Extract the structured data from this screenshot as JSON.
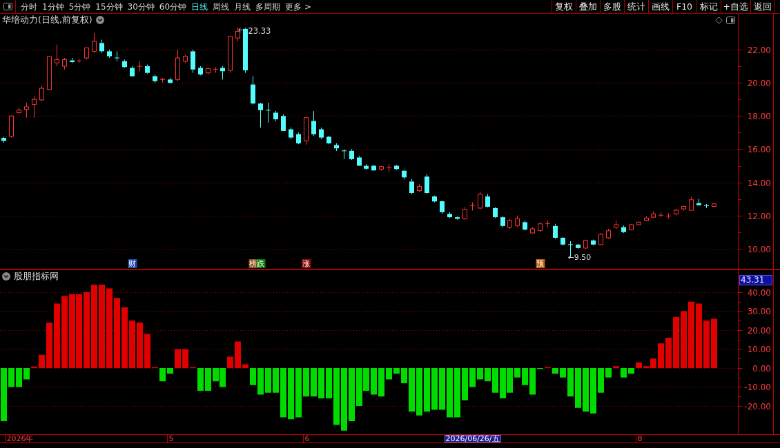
{
  "toolbar": {
    "periods": [
      {
        "label": "分时",
        "selected": false
      },
      {
        "label": "1分钟",
        "selected": false
      },
      {
        "label": "5分钟",
        "selected": false
      },
      {
        "label": "15分钟",
        "selected": false
      },
      {
        "label": "30分钟",
        "selected": false
      },
      {
        "label": "60分钟",
        "selected": false
      },
      {
        "label": "日线",
        "selected": true
      },
      {
        "label": "周线",
        "selected": false
      },
      {
        "label": "月线",
        "selected": false
      },
      {
        "label": "多周期",
        "selected": false
      }
    ],
    "more_menu": "更多 >",
    "buttons": [
      "复权",
      "叠加",
      "多股",
      "统计",
      "画线",
      "F10",
      "标记",
      "+自选",
      "返回"
    ]
  },
  "price_pane": {
    "title": "华培动力(日线,前复权)",
    "chart_data": [
      {
        "type": "candlestick",
        "grid": true,
        "ylim": [
          8.79,
          24.16
        ],
        "yticks": [
          {
            "value": 10,
            "label": "10.00"
          },
          {
            "value": 12,
            "label": "12.00"
          },
          {
            "value": 14,
            "label": "14.00"
          },
          {
            "value": 16,
            "label": "16.00"
          },
          {
            "value": 18,
            "label": "18.00"
          },
          {
            "value": 20,
            "label": "20.00"
          },
          {
            "value": 22,
            "label": "22.00"
          }
        ],
        "categories": [
          null,
          null,
          null,
          null,
          null,
          null,
          null,
          null,
          null,
          null,
          null,
          null,
          null,
          null,
          null,
          null,
          null,
          "财",
          null,
          null,
          null,
          null,
          null,
          null,
          null,
          null,
          null,
          null,
          null,
          null,
          null,
          null,
          null,
          "榜",
          "跌",
          null,
          null,
          null,
          null,
          null,
          "涨",
          null,
          null,
          null,
          null,
          null,
          null,
          null,
          null,
          null,
          null,
          null,
          null,
          null,
          null,
          null,
          null,
          null,
          null,
          null,
          null,
          null,
          null,
          null,
          null,
          null,
          null,
          null,
          null,
          null,
          null,
          "预",
          null,
          null,
          null,
          null,
          null,
          null,
          null,
          null,
          null,
          null,
          null,
          null,
          null,
          null,
          null,
          null,
          null,
          null,
          null,
          null,
          null,
          null,
          null
        ],
        "ohlc": [
          [
            16.68,
            16.75,
            16.4,
            16.5
          ],
          [
            16.78,
            18.05,
            16.7,
            18.0
          ],
          [
            18.2,
            18.5,
            18.1,
            18.35
          ],
          [
            18.4,
            18.8,
            17.9,
            18.55
          ],
          [
            18.7,
            19.2,
            17.9,
            19.0
          ],
          [
            18.97,
            19.8,
            18.9,
            19.67
          ],
          [
            19.6,
            21.6,
            19.55,
            21.58
          ],
          [
            21.2,
            22.3,
            21.0,
            21.4
          ],
          [
            21.0,
            21.5,
            20.8,
            21.4
          ],
          [
            21.35,
            21.5,
            21.2,
            21.25
          ],
          [
            21.3,
            21.45,
            21.2,
            21.32
          ],
          [
            21.5,
            22.15,
            21.4,
            22.1
          ],
          [
            21.9,
            23.0,
            21.8,
            22.5
          ],
          [
            22.4,
            22.6,
            21.8,
            21.9
          ],
          [
            21.9,
            22.0,
            21.5,
            21.6
          ],
          [
            21.5,
            21.9,
            21.3,
            21.45
          ],
          [
            21.3,
            21.4,
            20.9,
            20.95
          ],
          [
            20.9,
            21.0,
            20.35,
            20.4
          ],
          [
            20.95,
            21.3,
            20.7,
            21.0
          ],
          [
            21.0,
            21.1,
            20.55,
            20.6
          ],
          [
            20.4,
            20.5,
            20.0,
            20.1
          ],
          [
            20.15,
            20.3,
            20.0,
            20.2
          ],
          [
            20.2,
            20.3,
            19.95,
            20.0
          ],
          [
            20.2,
            22.0,
            20.1,
            21.5
          ],
          [
            21.3,
            21.7,
            21.2,
            21.6
          ],
          [
            21.9,
            22.0,
            20.6,
            20.8
          ],
          [
            20.9,
            21.0,
            20.45,
            20.5
          ],
          [
            20.6,
            20.9,
            20.5,
            20.85
          ],
          [
            20.8,
            20.95,
            20.6,
            20.82
          ],
          [
            20.9,
            21.0,
            20.2,
            20.7
          ],
          [
            20.75,
            22.85,
            20.6,
            22.8
          ],
          [
            22.7,
            23.33,
            22.5,
            23.1
          ],
          [
            23.25,
            23.3,
            20.6,
            20.75
          ],
          [
            19.9,
            20.4,
            18.7,
            18.75
          ],
          [
            18.75,
            18.8,
            17.3,
            18.35
          ],
          [
            18.35,
            18.8,
            17.6,
            18.3
          ],
          [
            18.2,
            18.3,
            17.7,
            17.8
          ],
          [
            18.0,
            18.1,
            17.1,
            17.1
          ],
          [
            17.2,
            17.3,
            16.6,
            16.7
          ],
          [
            16.9,
            17.0,
            16.3,
            16.35
          ],
          [
            16.5,
            17.95,
            16.27,
            17.9
          ],
          [
            17.7,
            18.3,
            16.8,
            16.9
          ],
          [
            17.2,
            17.3,
            16.6,
            16.7
          ],
          [
            16.75,
            16.8,
            16.3,
            16.35
          ],
          [
            16.25,
            16.35,
            15.9,
            16.05
          ],
          [
            15.9,
            16.0,
            15.4,
            15.85
          ],
          [
            15.9,
            16.0,
            15.35,
            15.4
          ],
          [
            15.5,
            15.6,
            15.0,
            15.0
          ],
          [
            15.0,
            15.1,
            14.75,
            14.82
          ],
          [
            15.0,
            15.05,
            14.7,
            14.72
          ],
          [
            14.8,
            15.0,
            14.7,
            14.95
          ],
          [
            14.85,
            15.1,
            14.6,
            14.9
          ],
          [
            15.0,
            15.05,
            14.75,
            14.8
          ],
          [
            14.7,
            14.75,
            14.2,
            14.3
          ],
          [
            14.05,
            14.2,
            13.3,
            13.36
          ],
          [
            13.5,
            13.9,
            13.4,
            13.75
          ],
          [
            14.35,
            14.5,
            13.3,
            13.36
          ],
          [
            13.15,
            13.2,
            12.8,
            12.85
          ],
          [
            12.86,
            12.9,
            12.1,
            12.2
          ],
          [
            12.1,
            12.2,
            11.85,
            11.9
          ],
          [
            11.9,
            11.95,
            11.75,
            11.8
          ],
          [
            11.8,
            12.5,
            11.75,
            12.37
          ],
          [
            12.55,
            12.8,
            12.3,
            12.6
          ],
          [
            12.45,
            13.45,
            12.4,
            13.28
          ],
          [
            13.15,
            13.3,
            12.5,
            12.53
          ],
          [
            12.45,
            12.5,
            11.85,
            11.9
          ],
          [
            11.9,
            11.95,
            11.3,
            11.37
          ],
          [
            11.3,
            11.8,
            11.2,
            11.7
          ],
          [
            11.4,
            12.0,
            11.3,
            11.8
          ],
          [
            11.6,
            11.7,
            11.1,
            11.15
          ],
          [
            10.95,
            11.3,
            10.9,
            11.2
          ],
          [
            11.1,
            11.6,
            11.0,
            11.5
          ],
          [
            11.5,
            11.7,
            11.3,
            11.52
          ],
          [
            11.37,
            11.5,
            10.6,
            10.66
          ],
          [
            10.66,
            10.7,
            10.2,
            10.25
          ],
          [
            10.25,
            10.45,
            9.5,
            10.22
          ],
          [
            10.25,
            10.3,
            10.0,
            10.04
          ],
          [
            10.04,
            10.55,
            10.0,
            10.5
          ],
          [
            10.5,
            10.55,
            10.2,
            10.25
          ],
          [
            10.25,
            10.95,
            10.2,
            10.87
          ],
          [
            10.66,
            11.2,
            10.6,
            11.08
          ],
          [
            11.3,
            11.7,
            11.2,
            11.45
          ],
          [
            11.3,
            11.4,
            10.95,
            11.0
          ],
          [
            11.15,
            11.5,
            11.1,
            11.45
          ],
          [
            11.45,
            11.65,
            11.4,
            11.6
          ],
          [
            11.7,
            11.95,
            11.65,
            11.85
          ],
          [
            11.9,
            12.25,
            11.85,
            12.1
          ],
          [
            12.0,
            12.2,
            11.9,
            12.02
          ],
          [
            11.95,
            12.15,
            11.8,
            11.97
          ],
          [
            12.1,
            12.4,
            12.0,
            12.32
          ],
          [
            12.4,
            12.6,
            12.3,
            12.55
          ],
          [
            12.32,
            13.15,
            12.3,
            12.95
          ],
          [
            12.75,
            13.0,
            12.6,
            12.62
          ],
          [
            12.6,
            12.7,
            12.45,
            12.55
          ],
          [
            12.55,
            12.75,
            12.5,
            12.7
          ]
        ],
        "annotations": [
          "23.33",
          "←9.50"
        ]
      }
    ],
    "event_tags": [
      {
        "color": "#1c4aa8"
      },
      {
        "color": "#8a4a12"
      },
      {
        "color": "#0e7a0e"
      },
      {
        "color": "#8c0a0a"
      },
      {
        "color": "#b85a0c"
      }
    ]
  },
  "indicator_pane": {
    "title": "股朋指标网",
    "current_value": "43.31",
    "chart_data": [
      {
        "type": "bar",
        "grid": true,
        "ylim": [
          -34.9,
          51.6
        ],
        "yticks": [
          {
            "value": -20,
            "label": "-20.00"
          },
          {
            "value": -10,
            "label": "-10.00"
          },
          {
            "value": 0,
            "label": "0.00"
          },
          {
            "value": 10,
            "label": "10.00"
          },
          {
            "value": 20,
            "label": "20.00"
          },
          {
            "value": 30,
            "label": "30.00"
          },
          {
            "value": 40,
            "label": "40.00"
          }
        ],
        "values": [
          -28,
          -10,
          -10,
          -6,
          0.8,
          7,
          24,
          34,
          38,
          39,
          39,
          40,
          44,
          44,
          42,
          37,
          32,
          25,
          24,
          18,
          0.5,
          -7,
          -3,
          10,
          10,
          0.5,
          -12,
          -12,
          -7,
          -10,
          6,
          14,
          2,
          -9,
          -14,
          -13,
          -13,
          -26,
          -27,
          -26,
          -15,
          -15,
          -16,
          -16,
          -30,
          -33,
          -28,
          -20,
          -12,
          -14,
          -15,
          -6,
          -3,
          -8,
          -23,
          -25,
          -23,
          -22,
          -22,
          -26,
          -26,
          -17,
          -10,
          -6,
          -7,
          -13,
          -16,
          -13,
          -5,
          -9,
          -14,
          -0.5,
          0.5,
          -3,
          -5,
          -15,
          -21,
          -23,
          -24,
          -13,
          -5,
          1,
          -5,
          -3,
          3,
          1,
          5,
          13,
          16,
          27,
          30,
          35,
          34,
          25,
          26
        ],
        "colors": [
          "#00dc00",
          "#00dc00",
          "#00dc00",
          "#00dc00",
          "#e00000",
          "#e00000",
          "#e00000",
          "#e00000",
          "#e00000",
          "#e00000",
          "#e00000",
          "#e00000",
          "#e00000",
          "#e00000",
          "#e00000",
          "#e00000",
          "#e00000",
          "#e00000",
          "#e00000",
          "#e00000",
          "#e00000",
          "#00dc00",
          "#00dc00",
          "#e00000",
          "#e00000",
          "#e00000",
          "#00dc00",
          "#00dc00",
          "#00dc00",
          "#00dc00",
          "#e00000",
          "#e00000",
          "#e00000",
          "#00dc00",
          "#00dc00",
          "#00dc00",
          "#00dc00",
          "#00dc00",
          "#00dc00",
          "#00dc00",
          "#00dc00",
          "#00dc00",
          "#00dc00",
          "#00dc00",
          "#00dc00",
          "#00dc00",
          "#00dc00",
          "#00dc00",
          "#00dc00",
          "#00dc00",
          "#00dc00",
          "#00dc00",
          "#00dc00",
          "#00dc00",
          "#00dc00",
          "#00dc00",
          "#00dc00",
          "#00dc00",
          "#00dc00",
          "#00dc00",
          "#00dc00",
          "#00dc00",
          "#00dc00",
          "#00dc00",
          "#00dc00",
          "#00dc00",
          "#00dc00",
          "#00dc00",
          "#00dc00",
          "#00dc00",
          "#00dc00",
          "#00dc00",
          "#e00000",
          "#00dc00",
          "#00dc00",
          "#00dc00",
          "#00dc00",
          "#00dc00",
          "#00dc00",
          "#00dc00",
          "#00dc00",
          "#e00000",
          "#00dc00",
          "#00dc00",
          "#e00000",
          "#e00000",
          "#e00000",
          "#e00000",
          "#e00000",
          "#e00000",
          "#e00000",
          "#e00000",
          "#e00000",
          "#e00000",
          "#e00000"
        ],
        "categories": [
          null,
          null,
          "2026年",
          null,
          null,
          null,
          null,
          null,
          null,
          null,
          null,
          null,
          null,
          null,
          null,
          null,
          null,
          null,
          null,
          null,
          null,
          null,
          "5",
          null,
          null,
          null,
          null,
          null,
          null,
          null,
          null,
          null,
          null,
          null,
          null,
          null,
          null,
          null,
          null,
          null,
          "6",
          null,
          null,
          null,
          null,
          null,
          null,
          null,
          null,
          null,
          null,
          null,
          null,
          null,
          null,
          null,
          null,
          null,
          null,
          null,
          null,
          null,
          "2026/06/26/五",
          null,
          null,
          null,
          null,
          null,
          null,
          null,
          null,
          null,
          null,
          null,
          null,
          null,
          null,
          null,
          null,
          null,
          null,
          null,
          null,
          null,
          "8",
          null,
          null,
          null,
          null,
          null,
          null,
          null,
          null,
          null,
          null
        ]
      }
    ],
    "date_labels": [
      {
        "selected": false
      },
      {
        "selected": false
      },
      {
        "selected": false
      },
      {
        "selected": true
      },
      {
        "selected": false
      }
    ]
  }
}
